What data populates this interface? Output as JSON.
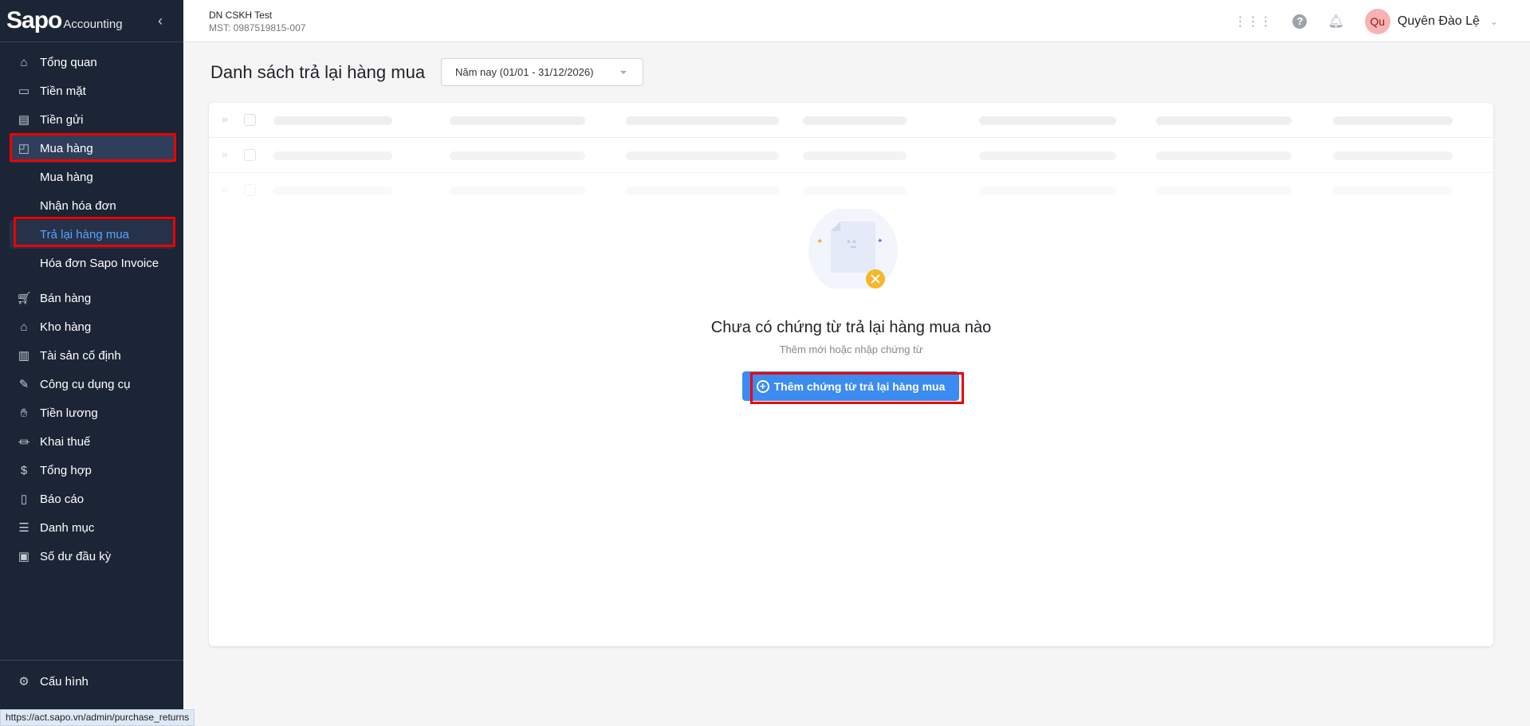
{
  "sidebar": {
    "logo_main": "Sapo",
    "logo_sub": "Accounting",
    "items": [
      {
        "label": "Tổng quan",
        "icon": "home-icon"
      },
      {
        "label": "Tiền mặt",
        "icon": "cash-icon"
      },
      {
        "label": "Tiền gửi",
        "icon": "card-icon"
      },
      {
        "label": "Mua hàng",
        "icon": "bag-icon"
      },
      {
        "label": "Mua hàng"
      },
      {
        "label": "Nhận hóa đơn"
      },
      {
        "label": "Trả lại hàng mua"
      },
      {
        "label": "Hóa đơn Sapo Invoice"
      },
      {
        "label": "Bán hàng",
        "icon": "cart-icon"
      },
      {
        "label": "Kho hàng",
        "icon": "warehouse-icon"
      },
      {
        "label": "Tài sản cố định",
        "icon": "building-icon"
      },
      {
        "label": "Công cụ dụng cụ",
        "icon": "tool-icon"
      },
      {
        "label": "Tiền lương",
        "icon": "salary-icon"
      },
      {
        "label": "Khai thuế",
        "icon": "bank-icon"
      },
      {
        "label": "Tổng hợp",
        "icon": "ledger-icon"
      },
      {
        "label": "Báo cáo",
        "icon": "report-icon"
      },
      {
        "label": "Danh mục",
        "icon": "list-icon"
      },
      {
        "label": "Số dư đầu kỳ",
        "icon": "wallet-icon"
      }
    ],
    "settings_label": "Cấu hình"
  },
  "status_url": "https://act.sapo.vn/admin/purchase_returns",
  "header": {
    "org_name": "DN CSKH Test",
    "org_tax": "MST: 0987519815-007",
    "avatar_initials": "Qu",
    "user_name": "Quyên Đào Lệ"
  },
  "main": {
    "title": "Danh sách trả lại hàng mua",
    "period": "Năm nay (01/01 - 31/12/2026)",
    "empty_title": "Chưa có chứng từ trả lại hàng mua nào",
    "empty_sub": "Thêm mới hoặc nhập chứng từ",
    "add_button": "Thêm chứng từ trả lại hàng mua"
  },
  "colors": {
    "sidebar": "#1c2536",
    "accent": "#3b8bf0",
    "active_sub": "#5aa2ff",
    "highlight": "#ee0000"
  }
}
